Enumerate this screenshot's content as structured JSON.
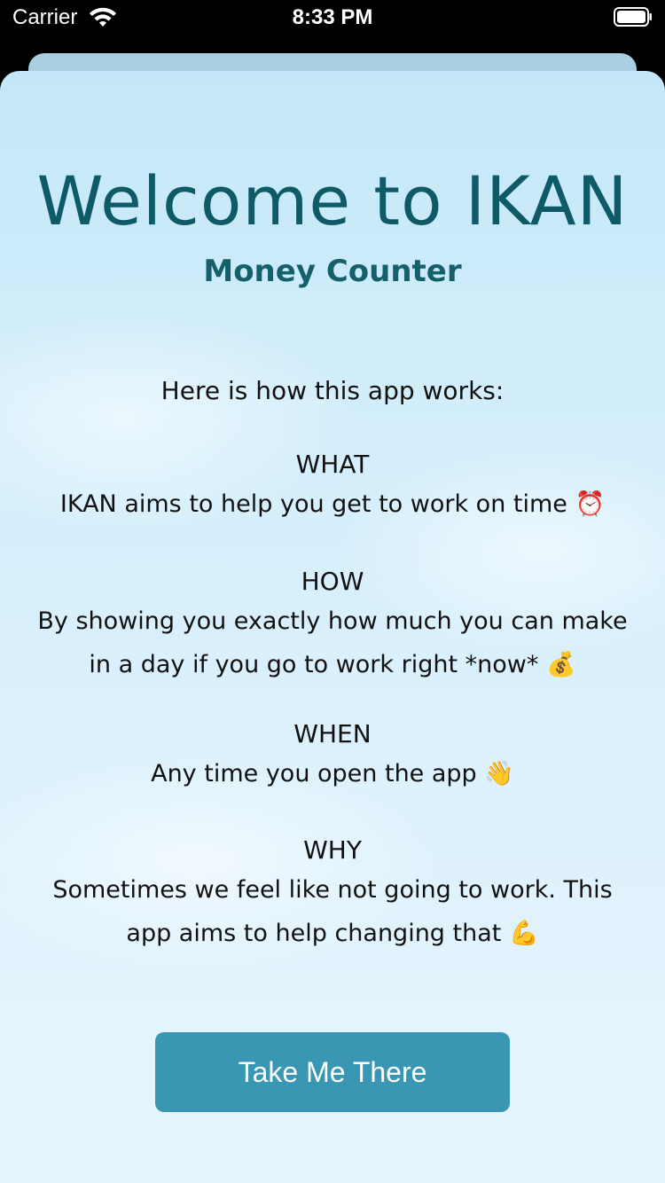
{
  "status_bar": {
    "carrier": "Carrier",
    "time": "8:33 PM"
  },
  "welcome": {
    "title": "Welcome to IKAN",
    "subtitle": "Money Counter",
    "intro": "Here is how this app works:",
    "sections": [
      {
        "heading": "WHAT",
        "body": "IKAN aims to help you get to work on time ⏰"
      },
      {
        "heading": "HOW",
        "body": "By showing you exactly how much you can make in a day if you go to work right *now* 💰"
      },
      {
        "heading": "WHEN",
        "body": "Any time you open the app 👋"
      },
      {
        "heading": "WHY",
        "body": "Sometimes we feel like not going to work. This app aims to help changing that 💪"
      }
    ],
    "cta_label": "Take Me There"
  },
  "colors": {
    "title": "#0e5a66",
    "button": "#3a97b3",
    "background_top": "#c3e7f8",
    "background_bottom": "#e6f5fd"
  }
}
